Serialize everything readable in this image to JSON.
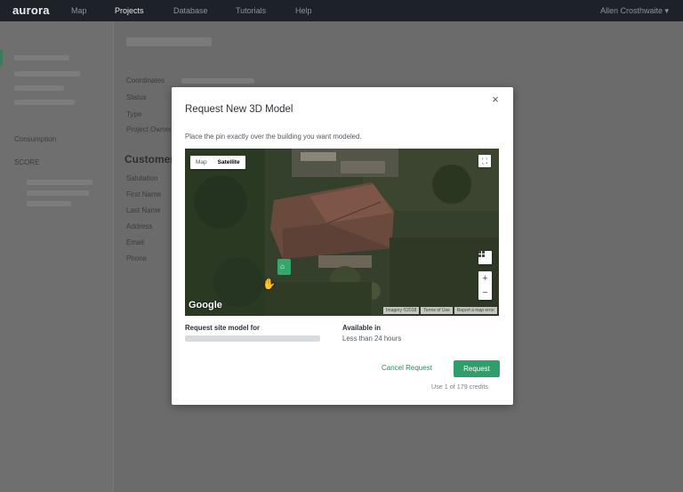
{
  "nav": {
    "logo": "aurora",
    "links": [
      "Map",
      "Projects",
      "Database",
      "Tutorials",
      "Help"
    ],
    "user": "Allen Crosthwaite ▾"
  },
  "sidebar": {
    "heading": "Consumption",
    "item": "SCORE"
  },
  "main": {
    "field_labels": [
      "Coordinates",
      "Status",
      "Type",
      "Project Owner"
    ],
    "section_title": "Customer",
    "customer_labels": [
      "Salutation",
      "First Name",
      "Last Name",
      "Address",
      "Email",
      "Phone"
    ]
  },
  "modal": {
    "title": "Request New 3D Model",
    "close": "×",
    "instruction": "Place the pin exactly over the building you want modeled.",
    "map": {
      "type_map": "Map",
      "type_satellite": "Satellite",
      "fullscreen_icon": "fullscreen-icon",
      "zoom_in": "+",
      "zoom_out": "−",
      "google": "Google",
      "attribution": [
        "Imagery ©2018",
        "Terms of Use",
        "Report a map error"
      ]
    },
    "request_label": "Request site model for",
    "available_label": "Available in",
    "available_value": "Less than 24 hours",
    "cancel_label": "Cancel Request",
    "request_button": "Request",
    "credits": "Use 1 of 179 credits"
  }
}
